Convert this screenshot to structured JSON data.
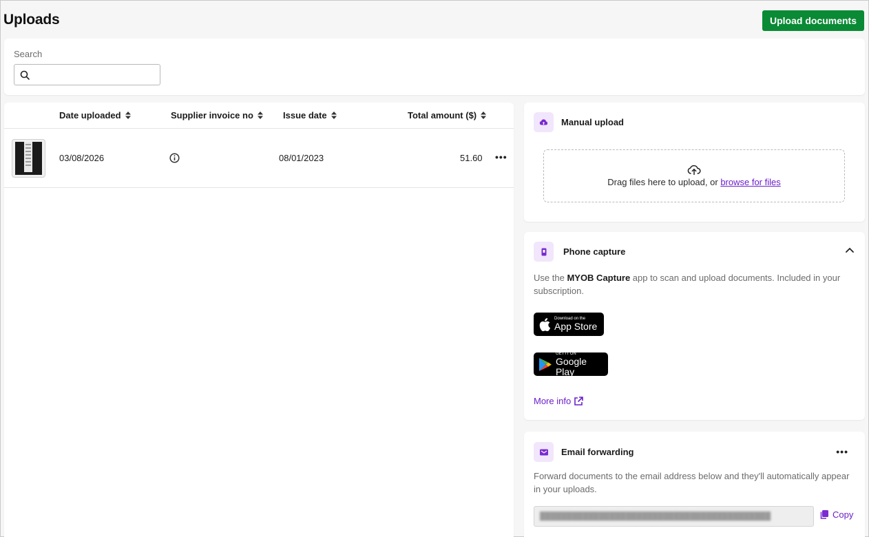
{
  "header": {
    "title": "Uploads",
    "upload_button": "Upload documents"
  },
  "search": {
    "label": "Search",
    "value": ""
  },
  "table": {
    "columns": [
      "Date uploaded",
      "Supplier invoice no",
      "Issue date",
      "Total amount ($)"
    ],
    "rows": [
      {
        "date_uploaded": "03/08/2026",
        "supplier_invoice_no": "",
        "issue_date": "08/01/2023",
        "total_amount": "51.60"
      }
    ]
  },
  "manual_upload": {
    "title": "Manual upload",
    "drop_text": "Drag files here to upload, or",
    "browse_link": "browse for files"
  },
  "phone_capture": {
    "title": "Phone capture",
    "desc_prefix": "Use the",
    "app_name": "MYOB Capture",
    "desc_suffix": "app to scan and upload documents. Included in your subscription.",
    "app_store": {
      "small": "Download on the",
      "big": "App Store"
    },
    "google_play": {
      "small": "GET IT ON",
      "big": "Google Play"
    },
    "more_info": "More info"
  },
  "email_forwarding": {
    "title": "Email forwarding",
    "description": "Forward documents to the email address below and they'll automatically appear in your uploads.",
    "copy_label": "Copy"
  },
  "colors": {
    "brand_green": "#0a8a35",
    "accent_purple": "#6b1ec9",
    "icon_bg": "#f1e6fb"
  }
}
